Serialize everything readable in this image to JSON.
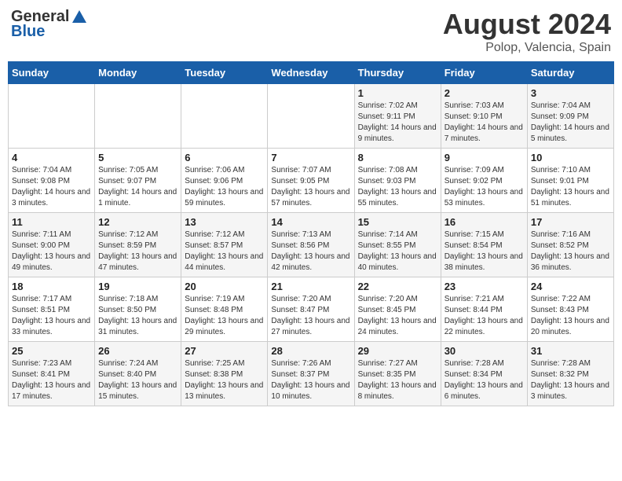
{
  "header": {
    "logo_general": "General",
    "logo_blue": "Blue",
    "title": "August 2024",
    "subtitle": "Polop, Valencia, Spain"
  },
  "weekdays": [
    "Sunday",
    "Monday",
    "Tuesday",
    "Wednesday",
    "Thursday",
    "Friday",
    "Saturday"
  ],
  "weeks": [
    [
      null,
      null,
      null,
      null,
      {
        "day": "1",
        "sunrise": "7:02 AM",
        "sunset": "9:11 PM",
        "daylight": "14 hours and 9 minutes."
      },
      {
        "day": "2",
        "sunrise": "7:03 AM",
        "sunset": "9:10 PM",
        "daylight": "14 hours and 7 minutes."
      },
      {
        "day": "3",
        "sunrise": "7:04 AM",
        "sunset": "9:09 PM",
        "daylight": "14 hours and 5 minutes."
      }
    ],
    [
      {
        "day": "4",
        "sunrise": "7:04 AM",
        "sunset": "9:08 PM",
        "daylight": "14 hours and 3 minutes."
      },
      {
        "day": "5",
        "sunrise": "7:05 AM",
        "sunset": "9:07 PM",
        "daylight": "14 hours and 1 minute."
      },
      {
        "day": "6",
        "sunrise": "7:06 AM",
        "sunset": "9:06 PM",
        "daylight": "13 hours and 59 minutes."
      },
      {
        "day": "7",
        "sunrise": "7:07 AM",
        "sunset": "9:05 PM",
        "daylight": "13 hours and 57 minutes."
      },
      {
        "day": "8",
        "sunrise": "7:08 AM",
        "sunset": "9:03 PM",
        "daylight": "13 hours and 55 minutes."
      },
      {
        "day": "9",
        "sunrise": "7:09 AM",
        "sunset": "9:02 PM",
        "daylight": "13 hours and 53 minutes."
      },
      {
        "day": "10",
        "sunrise": "7:10 AM",
        "sunset": "9:01 PM",
        "daylight": "13 hours and 51 minutes."
      }
    ],
    [
      {
        "day": "11",
        "sunrise": "7:11 AM",
        "sunset": "9:00 PM",
        "daylight": "13 hours and 49 minutes."
      },
      {
        "day": "12",
        "sunrise": "7:12 AM",
        "sunset": "8:59 PM",
        "daylight": "13 hours and 47 minutes."
      },
      {
        "day": "13",
        "sunrise": "7:12 AM",
        "sunset": "8:57 PM",
        "daylight": "13 hours and 44 minutes."
      },
      {
        "day": "14",
        "sunrise": "7:13 AM",
        "sunset": "8:56 PM",
        "daylight": "13 hours and 42 minutes."
      },
      {
        "day": "15",
        "sunrise": "7:14 AM",
        "sunset": "8:55 PM",
        "daylight": "13 hours and 40 minutes."
      },
      {
        "day": "16",
        "sunrise": "7:15 AM",
        "sunset": "8:54 PM",
        "daylight": "13 hours and 38 minutes."
      },
      {
        "day": "17",
        "sunrise": "7:16 AM",
        "sunset": "8:52 PM",
        "daylight": "13 hours and 36 minutes."
      }
    ],
    [
      {
        "day": "18",
        "sunrise": "7:17 AM",
        "sunset": "8:51 PM",
        "daylight": "13 hours and 33 minutes."
      },
      {
        "day": "19",
        "sunrise": "7:18 AM",
        "sunset": "8:50 PM",
        "daylight": "13 hours and 31 minutes."
      },
      {
        "day": "20",
        "sunrise": "7:19 AM",
        "sunset": "8:48 PM",
        "daylight": "13 hours and 29 minutes."
      },
      {
        "day": "21",
        "sunrise": "7:20 AM",
        "sunset": "8:47 PM",
        "daylight": "13 hours and 27 minutes."
      },
      {
        "day": "22",
        "sunrise": "7:20 AM",
        "sunset": "8:45 PM",
        "daylight": "13 hours and 24 minutes."
      },
      {
        "day": "23",
        "sunrise": "7:21 AM",
        "sunset": "8:44 PM",
        "daylight": "13 hours and 22 minutes."
      },
      {
        "day": "24",
        "sunrise": "7:22 AM",
        "sunset": "8:43 PM",
        "daylight": "13 hours and 20 minutes."
      }
    ],
    [
      {
        "day": "25",
        "sunrise": "7:23 AM",
        "sunset": "8:41 PM",
        "daylight": "13 hours and 17 minutes."
      },
      {
        "day": "26",
        "sunrise": "7:24 AM",
        "sunset": "8:40 PM",
        "daylight": "13 hours and 15 minutes."
      },
      {
        "day": "27",
        "sunrise": "7:25 AM",
        "sunset": "8:38 PM",
        "daylight": "13 hours and 13 minutes."
      },
      {
        "day": "28",
        "sunrise": "7:26 AM",
        "sunset": "8:37 PM",
        "daylight": "13 hours and 10 minutes."
      },
      {
        "day": "29",
        "sunrise": "7:27 AM",
        "sunset": "8:35 PM",
        "daylight": "13 hours and 8 minutes."
      },
      {
        "day": "30",
        "sunrise": "7:28 AM",
        "sunset": "8:34 PM",
        "daylight": "13 hours and 6 minutes."
      },
      {
        "day": "31",
        "sunrise": "7:28 AM",
        "sunset": "8:32 PM",
        "daylight": "13 hours and 3 minutes."
      }
    ]
  ],
  "labels": {
    "sunrise": "Sunrise:",
    "sunset": "Sunset:",
    "daylight": "Daylight:"
  }
}
